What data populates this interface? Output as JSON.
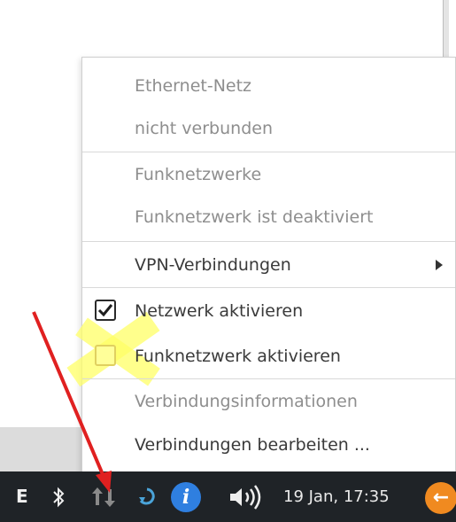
{
  "menu": {
    "ethernet_header": "Ethernet-Netz",
    "ethernet_status": "nicht verbunden",
    "wifi_header": "Funknetzwerke",
    "wifi_status": "Funknetzwerk ist deaktiviert",
    "vpn_label": "VPN-Verbindungen",
    "enable_network_label": "Netzwerk aktivieren",
    "enable_network_checked": true,
    "enable_wifi_label": "Funknetzwerk aktivieren",
    "enable_wifi_checked": false,
    "connection_info_label": "Verbindungsinformationen",
    "edit_connections_label": "Verbindungen bearbeiten ..."
  },
  "taskbar": {
    "keyboard_layout": "E",
    "clock": "19 Jan, 17:35",
    "icons": [
      "bluetooth-icon",
      "network-icon",
      "sync-icon",
      "info-icon",
      "volume-icon",
      "logout-icon"
    ]
  },
  "colors": {
    "taskbar_bg": "#1f2327",
    "highlight": "#ffff66",
    "annotation_arrow": "#e02020",
    "info_blue": "#2f7fe0",
    "logout_orange": "#f08a20"
  }
}
